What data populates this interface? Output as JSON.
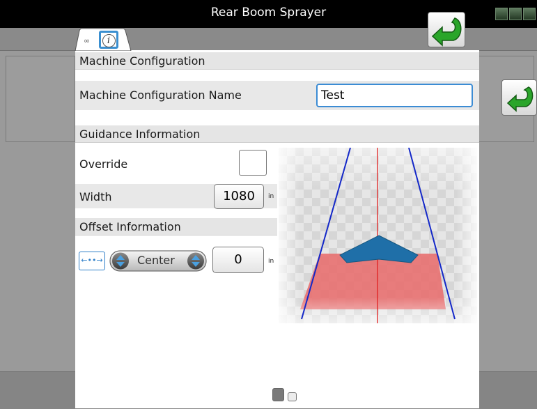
{
  "window": {
    "title": "Rear Boom Sprayer"
  },
  "top_icons": [
    "status-icon-1",
    "status-icon-2",
    "status-icon-3"
  ],
  "tabs": [
    {
      "icon": "link-icon",
      "active": false
    },
    {
      "icon": "info-icon",
      "active": true
    }
  ],
  "sections": {
    "machine": {
      "header": "Machine Configuration",
      "config_name_label": "Machine Configuration Name",
      "config_name_value": "Test"
    },
    "guidance": {
      "header": "Guidance Information",
      "override_label": "Override",
      "override_checked": false,
      "width_label": "Width",
      "width_value": "1080",
      "width_unit": "in"
    },
    "offset": {
      "header": "Offset Information",
      "direction_icon": "left-right-arrows-icon",
      "position_value": "Center",
      "offset_value": "0",
      "offset_unit": "in"
    }
  },
  "pagination": {
    "pages": 2,
    "current": 1
  },
  "colors": {
    "accent": "#3c8cd4",
    "guidance_line": "#1428c8",
    "center_line": "#e02020",
    "coverage": "#e87070",
    "vehicle": "#1f6fa8",
    "return_arrow": "#2aa52a"
  }
}
